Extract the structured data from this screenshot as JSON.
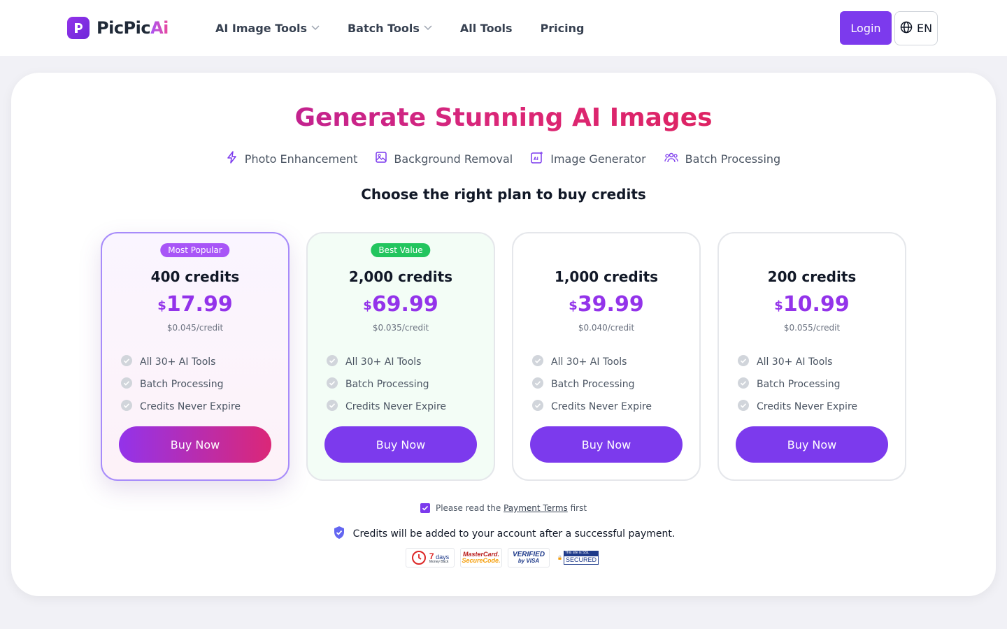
{
  "header": {
    "logo": {
      "text_main": "PicPic",
      "text_accent": "Ai"
    },
    "nav": [
      {
        "label": "AI Image Tools",
        "has_dropdown": true
      },
      {
        "label": "Batch Tools",
        "has_dropdown": true
      },
      {
        "label": "All Tools",
        "has_dropdown": false
      },
      {
        "label": "Pricing",
        "has_dropdown": false
      }
    ],
    "login_label": "Login",
    "language_label": "EN"
  },
  "hero": {
    "title": "Generate Stunning AI Images",
    "features": [
      {
        "icon": "lightning-icon",
        "label": "Photo Enhancement"
      },
      {
        "icon": "image-icon",
        "label": "Background Removal"
      },
      {
        "icon": "ai-image-icon",
        "label": "Image Generator"
      },
      {
        "icon": "users-icon",
        "label": "Batch Processing"
      }
    ],
    "subtitle": "Choose the right plan to buy credits"
  },
  "plans": [
    {
      "badge": "Most Popular",
      "credits": "400 credits",
      "currency": "$",
      "price": "17.99",
      "per_credit": "$0.045/credit",
      "button": "Buy Now"
    },
    {
      "badge": "Best Value",
      "credits": "2,000 credits",
      "currency": "$",
      "price": "69.99",
      "per_credit": "$0.035/credit",
      "button": "Buy Now"
    },
    {
      "badge": "",
      "credits": "1,000 credits",
      "currency": "$",
      "price": "39.99",
      "per_credit": "$0.040/credit",
      "button": "Buy Now"
    },
    {
      "badge": "",
      "credits": "200 credits",
      "currency": "$",
      "price": "10.99",
      "per_credit": "$0.055/credit",
      "button": "Buy Now"
    }
  ],
  "plan_features": [
    "All 30+ AI Tools",
    "Batch Processing",
    "Credits Never Expire"
  ],
  "footer": {
    "terms_prefix": "Please read the",
    "terms_link": "Payment Terms",
    "terms_suffix": "first",
    "terms_checked": true,
    "secure_note": "Credits will be added to your account after a successful payment.",
    "trust_badges": {
      "money_back": {
        "number": "7",
        "unit": "days",
        "caption": "Money Back"
      },
      "mastercard": {
        "line1": "MasterCard.",
        "line2": "SecureCode."
      },
      "visa": {
        "line1": "VERIFIED",
        "line2": "by VISA"
      },
      "ssl": {
        "line1": "This site is SSL",
        "line2": "SECURED"
      }
    }
  },
  "colors": {
    "brand_purple": "#7c3aed",
    "accent_pink": "#db2777",
    "badge_green": "#22c55e",
    "badge_purple": "#a855f7"
  }
}
